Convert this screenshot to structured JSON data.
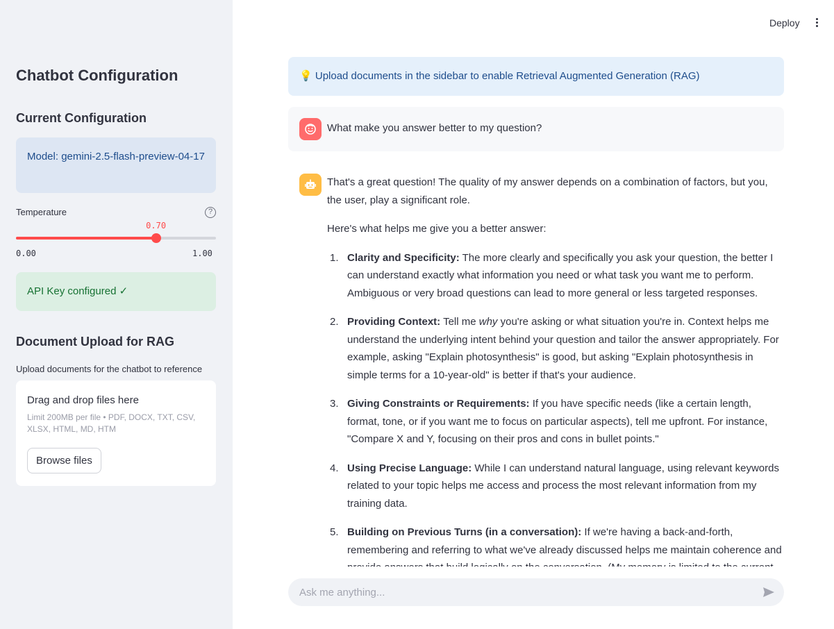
{
  "header": {
    "deploy_label": "Deploy",
    "menu_icon": "kebab-menu-icon"
  },
  "sidebar": {
    "title": "Chatbot Configuration",
    "current_config_heading": "Current Configuration",
    "model_text": "Model: gemini-2.5-flash-preview-04-17",
    "temperature": {
      "label": "Temperature",
      "value_display": "0.70",
      "value": 0.7,
      "min_label": "0.00",
      "max_label": "1.00",
      "min": 0,
      "max": 1
    },
    "api_status": "API Key configured ✓",
    "upload_heading": "Document Upload for RAG",
    "upload_caption": "Upload documents for the chatbot to reference",
    "dropzone": {
      "title": "Drag and drop files here",
      "limit": "Limit 200MB per file • PDF, DOCX, TXT, CSV, XLSX, HTML, MD, HTM",
      "browse_label": "Browse files"
    }
  },
  "main": {
    "info_icon": "💡",
    "info_text": "Upload documents in the sidebar to enable Retrieval Augmented Generation (RAG)",
    "user_message": "What make you answer better to my question?",
    "assistant": {
      "intro": "That's a great question! The quality of my answer depends on a combination of factors, but you, the user, play a significant role.",
      "lead": "Here's what helps me give you a better answer:",
      "items": [
        {
          "num": "1.",
          "title": "Clarity and Specificity:",
          "text": " The more clearly and specifically you ask your question, the better I can understand exactly what information you need or what task you want me to perform. Ambiguous or very broad questions can lead to more general or less targeted responses."
        },
        {
          "num": "2.",
          "title": "Providing Context:",
          "text_before": " Tell me ",
          "text_em": "why",
          "text_after": " you're asking or what situation you're in. Context helps me understand the underlying intent behind your question and tailor the answer appropriately. For example, asking \"Explain photosynthesis\" is good, but asking \"Explain photosynthesis in simple terms for a 10-year-old\" is better if that's your audience."
        },
        {
          "num": "3.",
          "title": "Giving Constraints or Requirements:",
          "text": " If you have specific needs (like a certain length, format, tone, or if you want me to focus on particular aspects), tell me upfront. For instance, \"Compare X and Y, focusing on their pros and cons in bullet points.\""
        },
        {
          "num": "4.",
          "title": "Using Precise Language:",
          "text": " While I can understand natural language, using relevant keywords related to your topic helps me access and process the most relevant information from my training data."
        },
        {
          "num": "5.",
          "title": "Building on Previous Turns (in a conversation):",
          "text": " If we're having a back-and-forth, remembering and referring to what we've already discussed helps me maintain coherence and provide answers that build logically on the conversation. (My memory is limited to the current"
        }
      ]
    },
    "chat_input": {
      "placeholder": "Ask me anything..."
    }
  },
  "colors": {
    "accent": "#ff4b4b",
    "sidebar_bg": "#f0f2f6",
    "info_bg": "#e5f0fb",
    "success_bg": "#dcefe3",
    "user_avatar": "#ff6b6b",
    "bot_avatar": "#ffbd45"
  }
}
